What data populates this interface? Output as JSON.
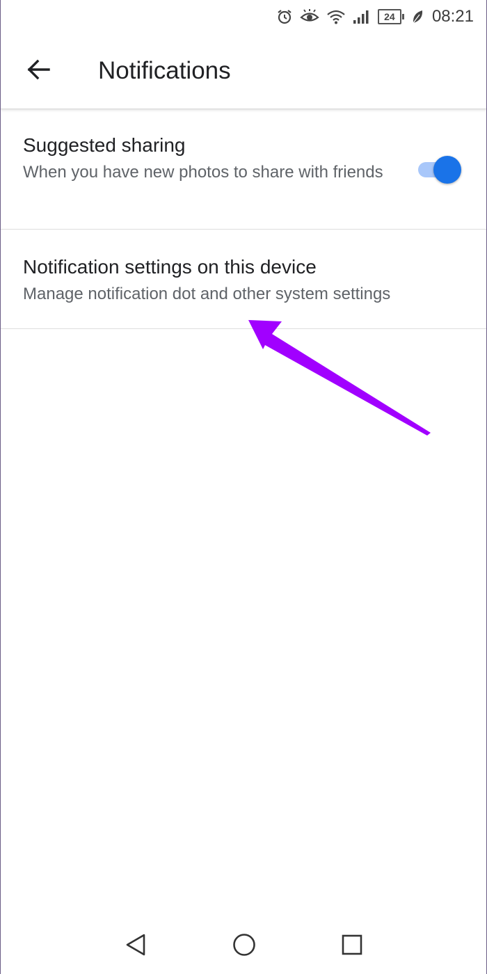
{
  "status_bar": {
    "icons": [
      "alarm-icon",
      "eye-comfort-icon",
      "wifi-icon",
      "signal-icon",
      "battery-icon",
      "leaf-icon"
    ],
    "battery_level": "24",
    "time": "08:21"
  },
  "app_bar": {
    "back_icon": "arrow-left-icon",
    "title": "Notifications"
  },
  "settings": [
    {
      "title": "Suggested sharing",
      "subtitle": "When you have new photos to share with friends",
      "toggle_on": true
    },
    {
      "title": "Notification settings on this device",
      "subtitle": "Manage notification dot and other system settings"
    }
  ],
  "colors": {
    "toggle_thumb": "#1a73e8",
    "toggle_track": "#a8c7fa",
    "annotation_arrow": "#a100ff",
    "title_text": "#202124",
    "subtitle_text": "#5f6368"
  },
  "nav_bar": {
    "icons": [
      "triangle-back-icon",
      "circle-home-icon",
      "square-recents-icon"
    ]
  }
}
